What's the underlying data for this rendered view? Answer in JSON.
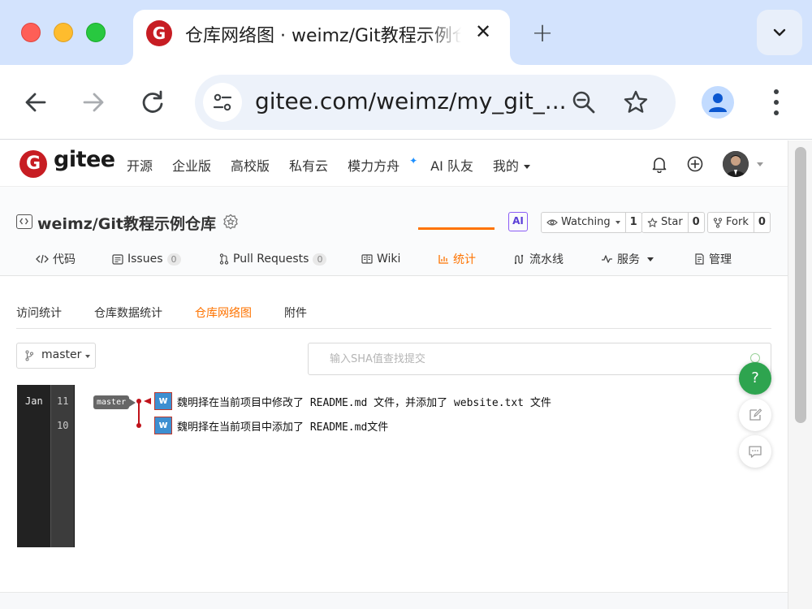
{
  "browser": {
    "tab_title": "仓库网络图 · weimz/Git教程示例仓库 - Gitee.com",
    "tab_favicon_letter": "G",
    "tab_close": "✕",
    "new_tab": "+",
    "url": "gitee.com/weimz/my_git_..."
  },
  "gitee": {
    "logo_letter": "G",
    "logo_text": "gitee",
    "nav": [
      "开源",
      "企业版",
      "高校版",
      "私有云",
      "模力方舟",
      "AI 队友",
      "我的"
    ],
    "sparkle": "✦"
  },
  "repo": {
    "title": "weimz/Git教程示例仓库",
    "ai_badge": "AI",
    "watching_label": "Watching",
    "watching_count": "1",
    "star_label": "Star",
    "star_count": "0",
    "fork_label": "Fork",
    "fork_count": "0",
    "tabs": [
      {
        "label": "代码",
        "icon": "code-icon"
      },
      {
        "label": "Issues",
        "count": "0",
        "icon": "issues-icon"
      },
      {
        "label": "Pull Requests",
        "count": "0",
        "icon": "pull-request-icon"
      },
      {
        "label": "Wiki",
        "icon": "wiki-icon"
      },
      {
        "label": "统计",
        "icon": "stats-icon"
      },
      {
        "label": "流水线",
        "icon": "pipeline-icon"
      },
      {
        "label": "服务",
        "icon": "service-icon"
      },
      {
        "label": "管理",
        "icon": "manage-icon"
      }
    ]
  },
  "stats_tabs": [
    "访问统计",
    "仓库数据统计",
    "仓库网络图",
    "附件"
  ],
  "graph": {
    "branch_select": "master",
    "sha_placeholder": "输入SHA值查找提交",
    "month": "Jan",
    "days": [
      "11",
      "10"
    ],
    "branch_tag": "master",
    "commits": [
      {
        "avatar": "w",
        "message": "魏明择在当前项目中修改了 README.md 文件，并添加了 website.txt 文件"
      },
      {
        "avatar": "w",
        "message": "魏明择在当前项目中添加了 README.md文件"
      }
    ]
  },
  "floating": {
    "help": "?"
  },
  "colors": {
    "accent": "#fe7300",
    "gitee_red": "#c71d23",
    "commit_line": "#c0121a",
    "help_green": "#2ea44f"
  }
}
